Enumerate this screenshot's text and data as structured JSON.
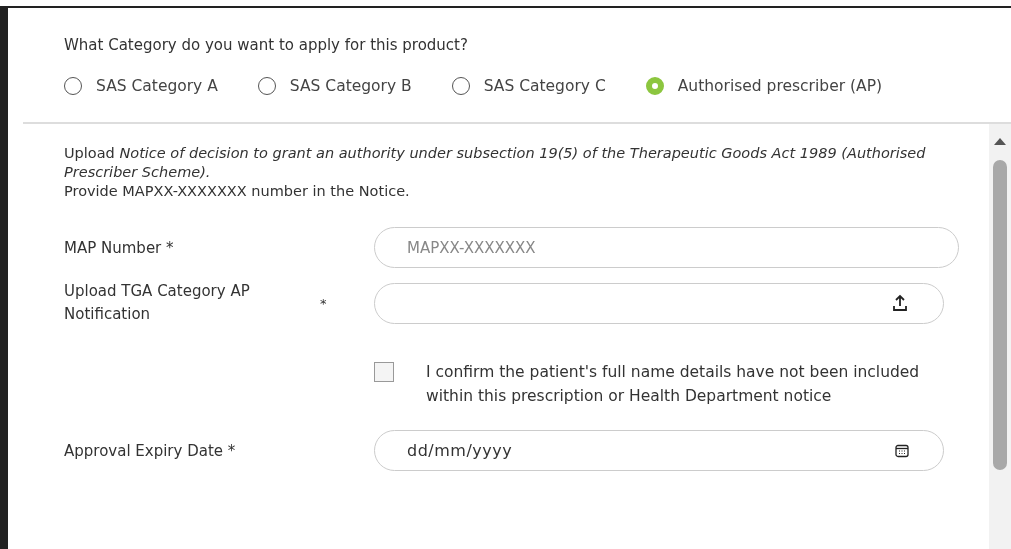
{
  "question": "What Category do you want to apply for this product?",
  "categories": [
    {
      "label": "SAS Category A",
      "selected": false
    },
    {
      "label": "SAS Category B",
      "selected": false
    },
    {
      "label": "SAS Category C",
      "selected": false
    },
    {
      "label": "Authorised prescriber (AP)",
      "selected": true
    }
  ],
  "upload_note": "Upload *Notice of decision to grant an authority under subsection 19(5) of the Therapeutic Goods Act 1989 (Authorised Prescriber Scheme).*",
  "provide_note": "Provide MAPXX-XXXXXXX number in the Notice.",
  "fields": [
    {
      "kind": "text",
      "label": "MAP Number *",
      "placeholder": "MAPXX-XXXXXXX"
    },
    {
      "kind": "file",
      "label": "Upload TGA Category AP Notification",
      "required_mark": "*"
    },
    {
      "kind": "checkbox",
      "label": "I confirm the patient's full name details have not been included within this prescription or Health Department notice",
      "checked": false
    },
    {
      "kind": "date",
      "label": "Approval Expiry Date *",
      "placeholder": "dd/mm/yyyy"
    }
  ]
}
